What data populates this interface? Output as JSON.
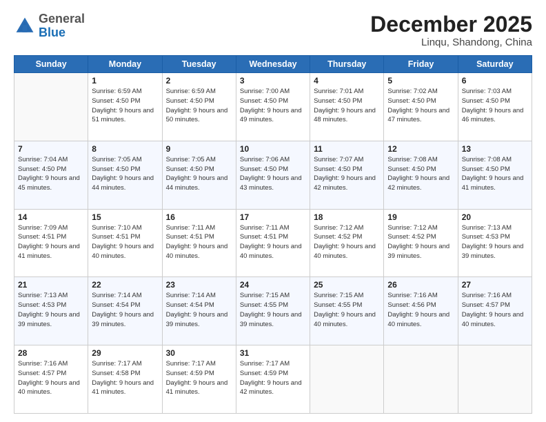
{
  "header": {
    "logo_line1": "General",
    "logo_line2": "Blue",
    "month_year": "December 2025",
    "location": "Linqu, Shandong, China"
  },
  "calendar": {
    "days_of_week": [
      "Sunday",
      "Monday",
      "Tuesday",
      "Wednesday",
      "Thursday",
      "Friday",
      "Saturday"
    ],
    "weeks": [
      [
        {
          "day": "",
          "sunrise": "",
          "sunset": "",
          "daylight": ""
        },
        {
          "day": "1",
          "sunrise": "Sunrise: 6:59 AM",
          "sunset": "Sunset: 4:50 PM",
          "daylight": "Daylight: 9 hours and 51 minutes."
        },
        {
          "day": "2",
          "sunrise": "Sunrise: 6:59 AM",
          "sunset": "Sunset: 4:50 PM",
          "daylight": "Daylight: 9 hours and 50 minutes."
        },
        {
          "day": "3",
          "sunrise": "Sunrise: 7:00 AM",
          "sunset": "Sunset: 4:50 PM",
          "daylight": "Daylight: 9 hours and 49 minutes."
        },
        {
          "day": "4",
          "sunrise": "Sunrise: 7:01 AM",
          "sunset": "Sunset: 4:50 PM",
          "daylight": "Daylight: 9 hours and 48 minutes."
        },
        {
          "day": "5",
          "sunrise": "Sunrise: 7:02 AM",
          "sunset": "Sunset: 4:50 PM",
          "daylight": "Daylight: 9 hours and 47 minutes."
        },
        {
          "day": "6",
          "sunrise": "Sunrise: 7:03 AM",
          "sunset": "Sunset: 4:50 PM",
          "daylight": "Daylight: 9 hours and 46 minutes."
        }
      ],
      [
        {
          "day": "7",
          "sunrise": "Sunrise: 7:04 AM",
          "sunset": "Sunset: 4:50 PM",
          "daylight": "Daylight: 9 hours and 45 minutes."
        },
        {
          "day": "8",
          "sunrise": "Sunrise: 7:05 AM",
          "sunset": "Sunset: 4:50 PM",
          "daylight": "Daylight: 9 hours and 44 minutes."
        },
        {
          "day": "9",
          "sunrise": "Sunrise: 7:05 AM",
          "sunset": "Sunset: 4:50 PM",
          "daylight": "Daylight: 9 hours and 44 minutes."
        },
        {
          "day": "10",
          "sunrise": "Sunrise: 7:06 AM",
          "sunset": "Sunset: 4:50 PM",
          "daylight": "Daylight: 9 hours and 43 minutes."
        },
        {
          "day": "11",
          "sunrise": "Sunrise: 7:07 AM",
          "sunset": "Sunset: 4:50 PM",
          "daylight": "Daylight: 9 hours and 42 minutes."
        },
        {
          "day": "12",
          "sunrise": "Sunrise: 7:08 AM",
          "sunset": "Sunset: 4:50 PM",
          "daylight": "Daylight: 9 hours and 42 minutes."
        },
        {
          "day": "13",
          "sunrise": "Sunrise: 7:08 AM",
          "sunset": "Sunset: 4:50 PM",
          "daylight": "Daylight: 9 hours and 41 minutes."
        }
      ],
      [
        {
          "day": "14",
          "sunrise": "Sunrise: 7:09 AM",
          "sunset": "Sunset: 4:51 PM",
          "daylight": "Daylight: 9 hours and 41 minutes."
        },
        {
          "day": "15",
          "sunrise": "Sunrise: 7:10 AM",
          "sunset": "Sunset: 4:51 PM",
          "daylight": "Daylight: 9 hours and 40 minutes."
        },
        {
          "day": "16",
          "sunrise": "Sunrise: 7:11 AM",
          "sunset": "Sunset: 4:51 PM",
          "daylight": "Daylight: 9 hours and 40 minutes."
        },
        {
          "day": "17",
          "sunrise": "Sunrise: 7:11 AM",
          "sunset": "Sunset: 4:51 PM",
          "daylight": "Daylight: 9 hours and 40 minutes."
        },
        {
          "day": "18",
          "sunrise": "Sunrise: 7:12 AM",
          "sunset": "Sunset: 4:52 PM",
          "daylight": "Daylight: 9 hours and 40 minutes."
        },
        {
          "day": "19",
          "sunrise": "Sunrise: 7:12 AM",
          "sunset": "Sunset: 4:52 PM",
          "daylight": "Daylight: 9 hours and 39 minutes."
        },
        {
          "day": "20",
          "sunrise": "Sunrise: 7:13 AM",
          "sunset": "Sunset: 4:53 PM",
          "daylight": "Daylight: 9 hours and 39 minutes."
        }
      ],
      [
        {
          "day": "21",
          "sunrise": "Sunrise: 7:13 AM",
          "sunset": "Sunset: 4:53 PM",
          "daylight": "Daylight: 9 hours and 39 minutes."
        },
        {
          "day": "22",
          "sunrise": "Sunrise: 7:14 AM",
          "sunset": "Sunset: 4:54 PM",
          "daylight": "Daylight: 9 hours and 39 minutes."
        },
        {
          "day": "23",
          "sunrise": "Sunrise: 7:14 AM",
          "sunset": "Sunset: 4:54 PM",
          "daylight": "Daylight: 9 hours and 39 minutes."
        },
        {
          "day": "24",
          "sunrise": "Sunrise: 7:15 AM",
          "sunset": "Sunset: 4:55 PM",
          "daylight": "Daylight: 9 hours and 39 minutes."
        },
        {
          "day": "25",
          "sunrise": "Sunrise: 7:15 AM",
          "sunset": "Sunset: 4:55 PM",
          "daylight": "Daylight: 9 hours and 40 minutes."
        },
        {
          "day": "26",
          "sunrise": "Sunrise: 7:16 AM",
          "sunset": "Sunset: 4:56 PM",
          "daylight": "Daylight: 9 hours and 40 minutes."
        },
        {
          "day": "27",
          "sunrise": "Sunrise: 7:16 AM",
          "sunset": "Sunset: 4:57 PM",
          "daylight": "Daylight: 9 hours and 40 minutes."
        }
      ],
      [
        {
          "day": "28",
          "sunrise": "Sunrise: 7:16 AM",
          "sunset": "Sunset: 4:57 PM",
          "daylight": "Daylight: 9 hours and 40 minutes."
        },
        {
          "day": "29",
          "sunrise": "Sunrise: 7:17 AM",
          "sunset": "Sunset: 4:58 PM",
          "daylight": "Daylight: 9 hours and 41 minutes."
        },
        {
          "day": "30",
          "sunrise": "Sunrise: 7:17 AM",
          "sunset": "Sunset: 4:59 PM",
          "daylight": "Daylight: 9 hours and 41 minutes."
        },
        {
          "day": "31",
          "sunrise": "Sunrise: 7:17 AM",
          "sunset": "Sunset: 4:59 PM",
          "daylight": "Daylight: 9 hours and 42 minutes."
        },
        {
          "day": "",
          "sunrise": "",
          "sunset": "",
          "daylight": ""
        },
        {
          "day": "",
          "sunrise": "",
          "sunset": "",
          "daylight": ""
        },
        {
          "day": "",
          "sunrise": "",
          "sunset": "",
          "daylight": ""
        }
      ]
    ]
  }
}
